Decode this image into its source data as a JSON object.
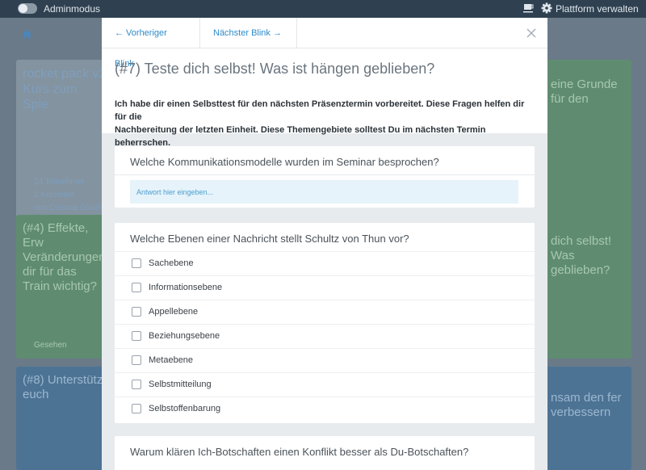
{
  "topbar": {
    "admin_label": "Adminmodus",
    "platform_label": "Plattform verwalten",
    "icons": [
      "toggle-switch",
      "coffee-cup-icon",
      "gear-icon"
    ]
  },
  "background": {
    "card1": {
      "title": "rocket pack v2 Kurs zum Spie",
      "participants": "24 Teilnehmer",
      "coaches": "2 Kursleiter",
      "author": "von Corinna Günthe"
    },
    "card2": {
      "title": "(#4) Effekte, Erw Veränderungen dir für das Train wichtig?",
      "seen": "Gesehen"
    },
    "card3": {
      "title": "(#8) Unterstütz euch"
    },
    "right1": {
      "title": "eine Grunde für den"
    },
    "right2": {
      "title": "dich selbst! Was geblieben?"
    },
    "right3": {
      "title": "nsam den fer verbessern"
    }
  },
  "modal": {
    "prev_label": "← Vorheriger Blink",
    "next_label": "Nächster Blink →",
    "title": "(#7) Teste dich selbst! Was ist hängen geblieben?",
    "description_line1": "Ich habe dir einen Selbsttest für den nächsten Präsenztermin vorbereitet. Diese Fragen helfen dir für die",
    "description_line2": "Nachbereitung der letzten Einheit. Diese Themengebiete solltest Du im nächsten Termin beherrschen.",
    "questions": [
      {
        "text": "Welche Kommunikationsmodelle wurden im Seminar besprochen?",
        "placeholder": "Antwort hier eingeben..."
      },
      {
        "text": "Welche Ebenen einer Nachricht stellt Schultz von Thun vor?",
        "options": [
          "Sachebene",
          "Informationsebene",
          "Appellebene",
          "Beziehungsebene",
          "Metaebene",
          "Selbstmitteilung",
          "Selbstoffenbarung"
        ]
      },
      {
        "text": "Warum klären Ich-Botschaften einen Konflikt besser als Du-Botschaften?"
      }
    ]
  },
  "colors": {
    "accent": "#2d8bc9",
    "green_card": "#5f8c70",
    "blue_card": "#4d7394",
    "topbar": "#2f4150"
  }
}
